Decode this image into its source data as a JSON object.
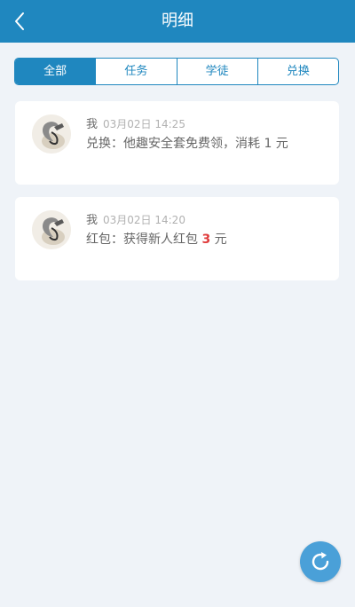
{
  "header": {
    "title": "明细",
    "back_icon": "chevron-left-icon"
  },
  "tabs": [
    {
      "label": "全部",
      "active": true
    },
    {
      "label": "任务",
      "active": false
    },
    {
      "label": "学徒",
      "active": false
    },
    {
      "label": "兑换",
      "active": false
    }
  ],
  "records": [
    {
      "name": "我",
      "time": "03月02日 14:25",
      "text": "兑换：他趣安全套免费领，消耗 1 元"
    },
    {
      "name": "我",
      "time": "03月02日 14:20",
      "text_prefix": "红包：获得新人红包 ",
      "amount": "3",
      "text_suffix": " 元"
    }
  ],
  "refresh": {
    "icon": "refresh-icon"
  },
  "colors": {
    "primary": "#1f87bf",
    "background": "#eff3f8",
    "amount": "#e03c3c"
  }
}
